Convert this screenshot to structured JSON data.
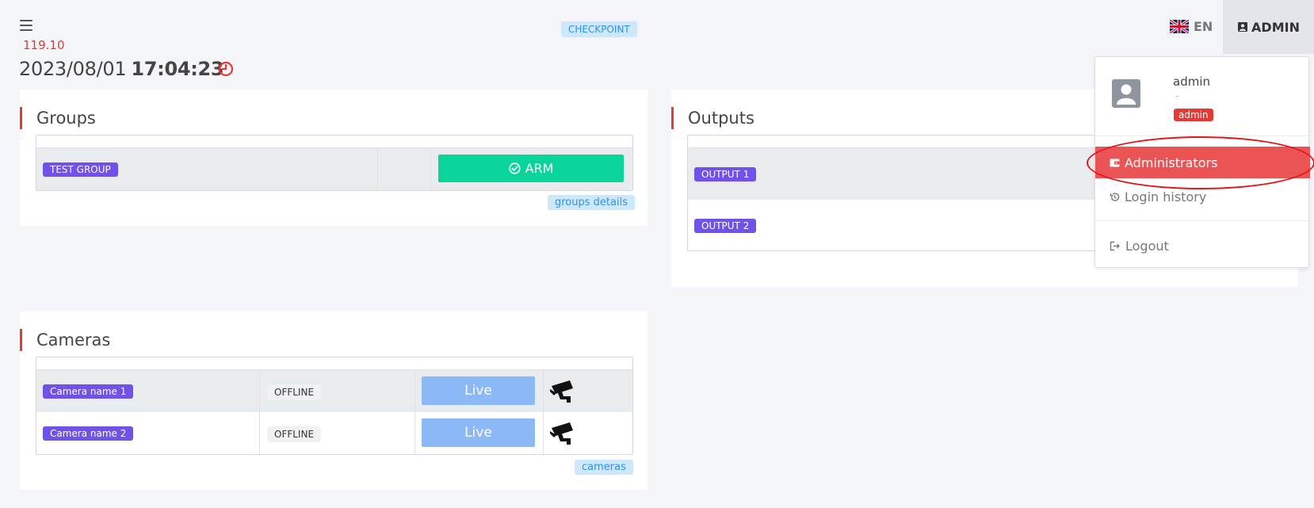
{
  "header": {
    "version": "119.10",
    "date": "2023/08/01",
    "time": "17:04:23",
    "checkpoint": "CHECKPOINT",
    "language": "EN",
    "admin_label": "ADMIN",
    "accent": "#e53935"
  },
  "groups": {
    "title": "Groups",
    "rows": [
      {
        "name": "TEST GROUP",
        "action": "ARM"
      }
    ],
    "details_link": "groups details"
  },
  "outputs": {
    "title": "Outputs",
    "rows": [
      {
        "name": "OUTPUT 1"
      },
      {
        "name": "OUTPUT 2"
      }
    ]
  },
  "cameras": {
    "title": "Cameras",
    "rows": [
      {
        "name": "Camera name 1",
        "status": "OFFLINE",
        "action": "Live",
        "icon": "cctv-camera-icon"
      },
      {
        "name": "Camera name 2",
        "status": "OFFLINE",
        "action": "Live",
        "icon": "cctv-camera-icon"
      }
    ],
    "link": "cameras"
  },
  "user_menu": {
    "username": "admin",
    "dash": "-",
    "role": "admin",
    "items": [
      {
        "label": "Administrators",
        "icon": "wallet-icon",
        "active": true
      },
      {
        "label": "Login history",
        "icon": "history-icon"
      },
      {
        "label": "Logout",
        "icon": "logout-icon"
      }
    ]
  }
}
